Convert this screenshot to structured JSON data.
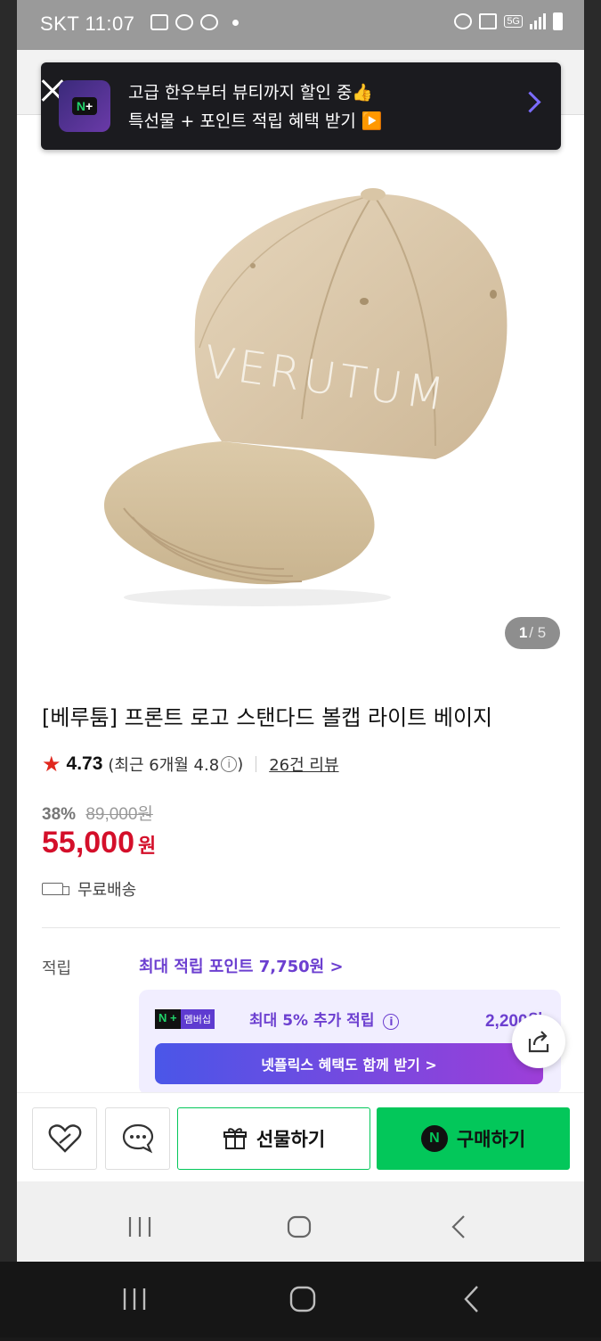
{
  "status_bar": {
    "carrier_time": "SKT 11:07",
    "network": "5G"
  },
  "promo": {
    "line1": "고급 한우부터 뷰티까지 할인 중👍",
    "line2": "특선물 + 포인트 적립 혜택 받기 ▶️",
    "logo_text": "N+"
  },
  "gallery": {
    "current": "1",
    "total": "/ 5",
    "hat_text": "VERUTUM"
  },
  "product": {
    "title": "[베루툼] 프론트 로고 스탠다드 볼캡 라이트 베이지",
    "rating": "4.73",
    "recent_rating": "(최근 6개월 4.8",
    "recent_rating_close": ")",
    "review_count": "26건 리뷰",
    "discount": "38%",
    "original_price": "89,000원",
    "price": "55,000",
    "currency": "원",
    "shipping": "무료배송"
  },
  "points": {
    "label": "적립",
    "max_link": "최대 적립 포인트 7,750원 >",
    "np_badge_logo": "N +",
    "np_badge_label": "멤버십",
    "np_text": "최대 5% 추가 적립",
    "np_amount": "2,200원",
    "netflix_button": "넷플릭스 혜택도 함께 받기 >"
  },
  "actions": {
    "gift": "선물하기",
    "buy": "구매하기",
    "npay_logo": "N"
  },
  "colors": {
    "accent_green": "#03c75a",
    "price_red": "#d40f2a",
    "point_purple": "#6c3fd0"
  }
}
